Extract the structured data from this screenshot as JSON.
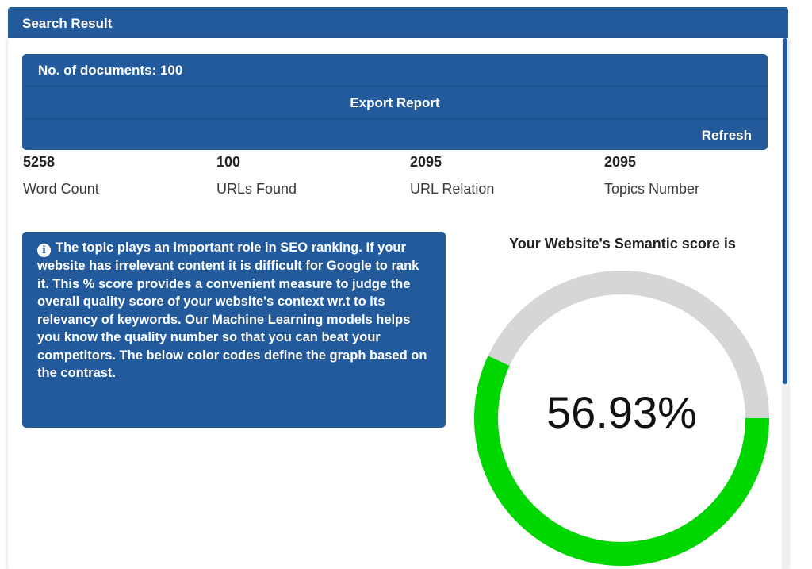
{
  "panel": {
    "title": "Search Result"
  },
  "actions": {
    "documents_label": "No. of documents: 100",
    "export_label": "Export Report",
    "refresh_label": "Refresh"
  },
  "stats": [
    {
      "value": "5258",
      "label": "Word Count"
    },
    {
      "value": "100",
      "label": "URLs Found"
    },
    {
      "value": "2095",
      "label": "URL Relation"
    },
    {
      "value": "2095",
      "label": "Topics Number"
    }
  ],
  "info": {
    "icon": "info-circle-icon",
    "text": "The topic plays an important role in SEO ranking. If your website has irrelevant content it is difficult for Google to rank it. This % score provides a convenient measure to judge the overall quality score of your website's context wr.t to its relevancy of keywords. Our Machine Learning models helps you know the quality number so that you can beat your competitors. The below color codes define the graph based on the contrast."
  },
  "score": {
    "title": "Your Website's Semantic score is",
    "value_text": "56.93%",
    "value": 56.93,
    "fill_color": "#00d600",
    "track_color": "#d6d6d6"
  },
  "colors": {
    "primary": "#235a9b"
  }
}
